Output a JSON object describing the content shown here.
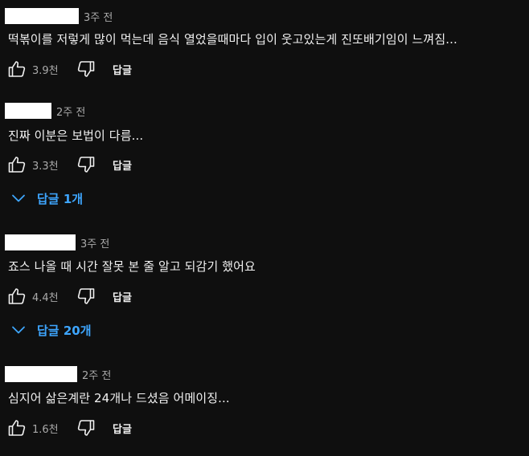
{
  "comments": [
    {
      "time": "3주 전",
      "text": "떡볶이를 저렇게 많이 먹는데 음식 열었을때마다 입이 웃고있는게 진또배기임이 느껴짐...",
      "likes": "3.9천",
      "reply_label": "답글"
    },
    {
      "time": "2주 전",
      "text": "진짜 이분은 보법이 다름...",
      "likes": "3.3천",
      "reply_label": "답글",
      "replies_label": "답글 1개"
    },
    {
      "time": "3주 전",
      "text": "죠스 나올 때 시간 잘못 본 줄 알고 되감기 했어요",
      "likes": "4.4천",
      "reply_label": "답글",
      "replies_label": "답글 20개"
    },
    {
      "time": "2주 전",
      "text": "심지어 삶은계란 24개나 드셨음 어메이징...",
      "likes": "1.6천",
      "reply_label": "답글"
    }
  ],
  "icons": {
    "like": "thumbs-up-icon",
    "dislike": "thumbs-down-icon",
    "expand": "chevron-down-icon"
  },
  "colors": {
    "background": "#0f0f0f",
    "text": "#f1f1f1",
    "secondary_text": "#aaaaaa",
    "link_blue": "#3ea6ff",
    "redaction": "#ffffff"
  }
}
